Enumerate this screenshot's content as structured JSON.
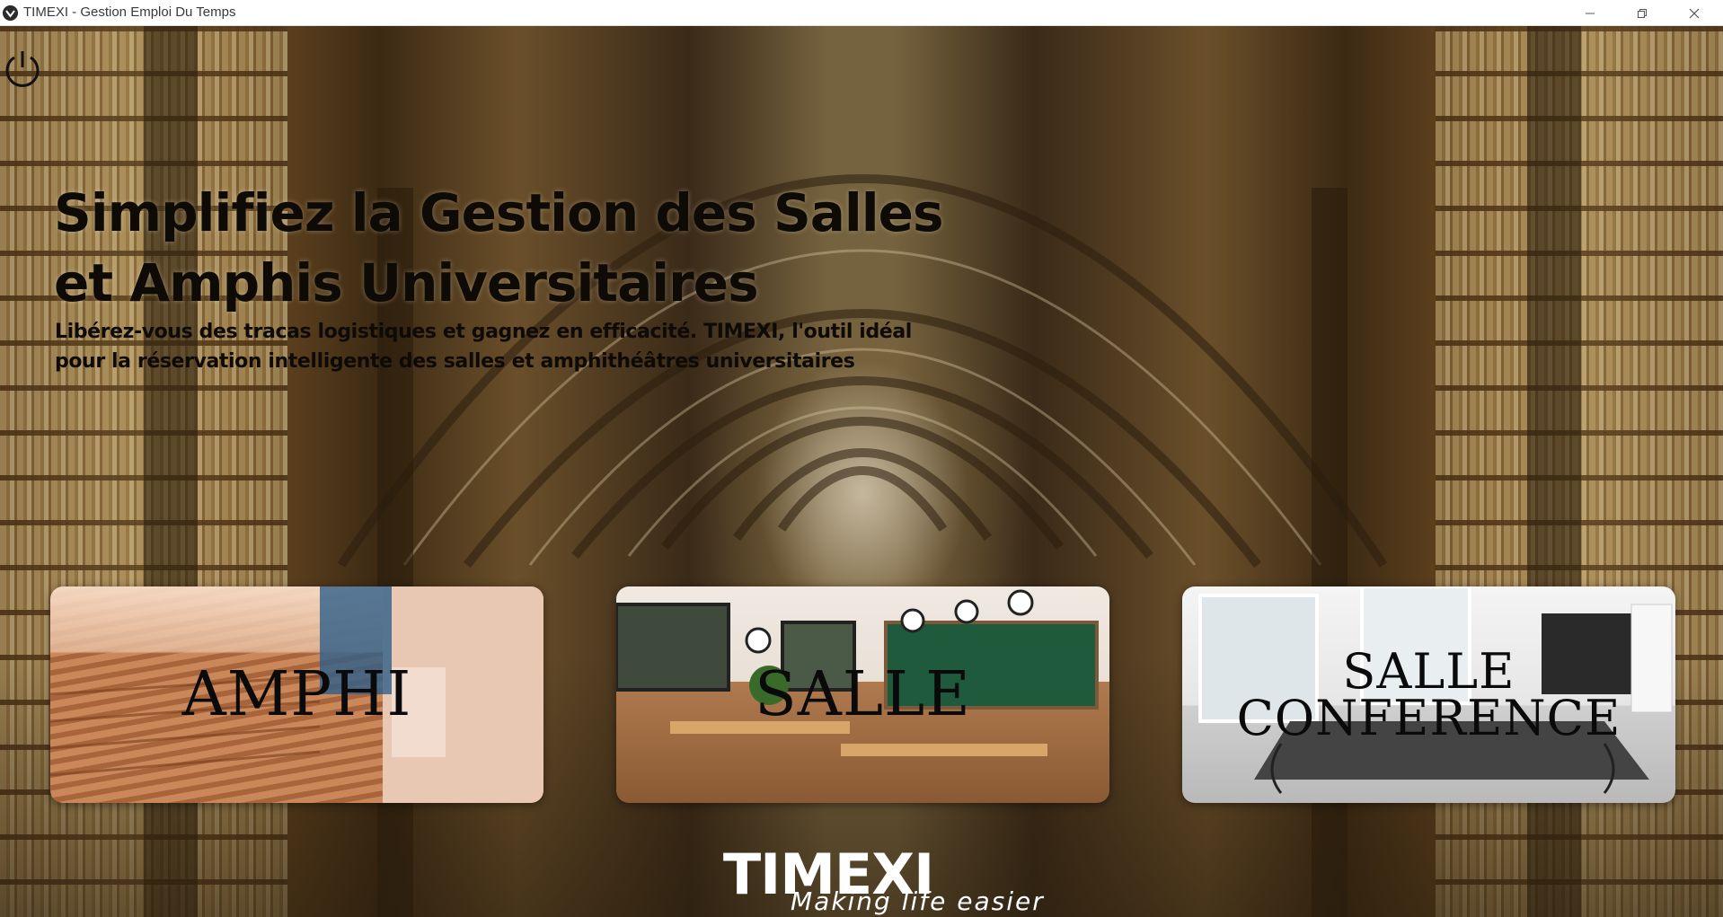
{
  "window": {
    "title": "TIMEXI - Gestion Emploi Du Temps",
    "controls": [
      "minimize",
      "maximize",
      "close"
    ]
  },
  "icons": {
    "app": "app-logo-icon",
    "power": "power-icon"
  },
  "hero": {
    "title_line1": "Simplifiez la Gestion des Salles",
    "title_line2": "et Amphis Universitaires",
    "subtitle_line1": "Libérez-vous des tracas logistiques et gagnez en efficacité. TIMEXI, l'outil idéal",
    "subtitle_line2": "pour la réservation intelligente des salles et amphithéâtres universitaires"
  },
  "cards": [
    {
      "label": "AMPHI"
    },
    {
      "label": "SALLE"
    },
    {
      "label_line1": "SALLE",
      "label_line2": "CONFERENCE"
    }
  ],
  "brand": {
    "name": "TIMEXI",
    "tagline": "Making life easier"
  },
  "colors": {
    "titlebar": "#ffffff",
    "headline_text": "#0e0a06",
    "brand_text": "#ffffff"
  }
}
